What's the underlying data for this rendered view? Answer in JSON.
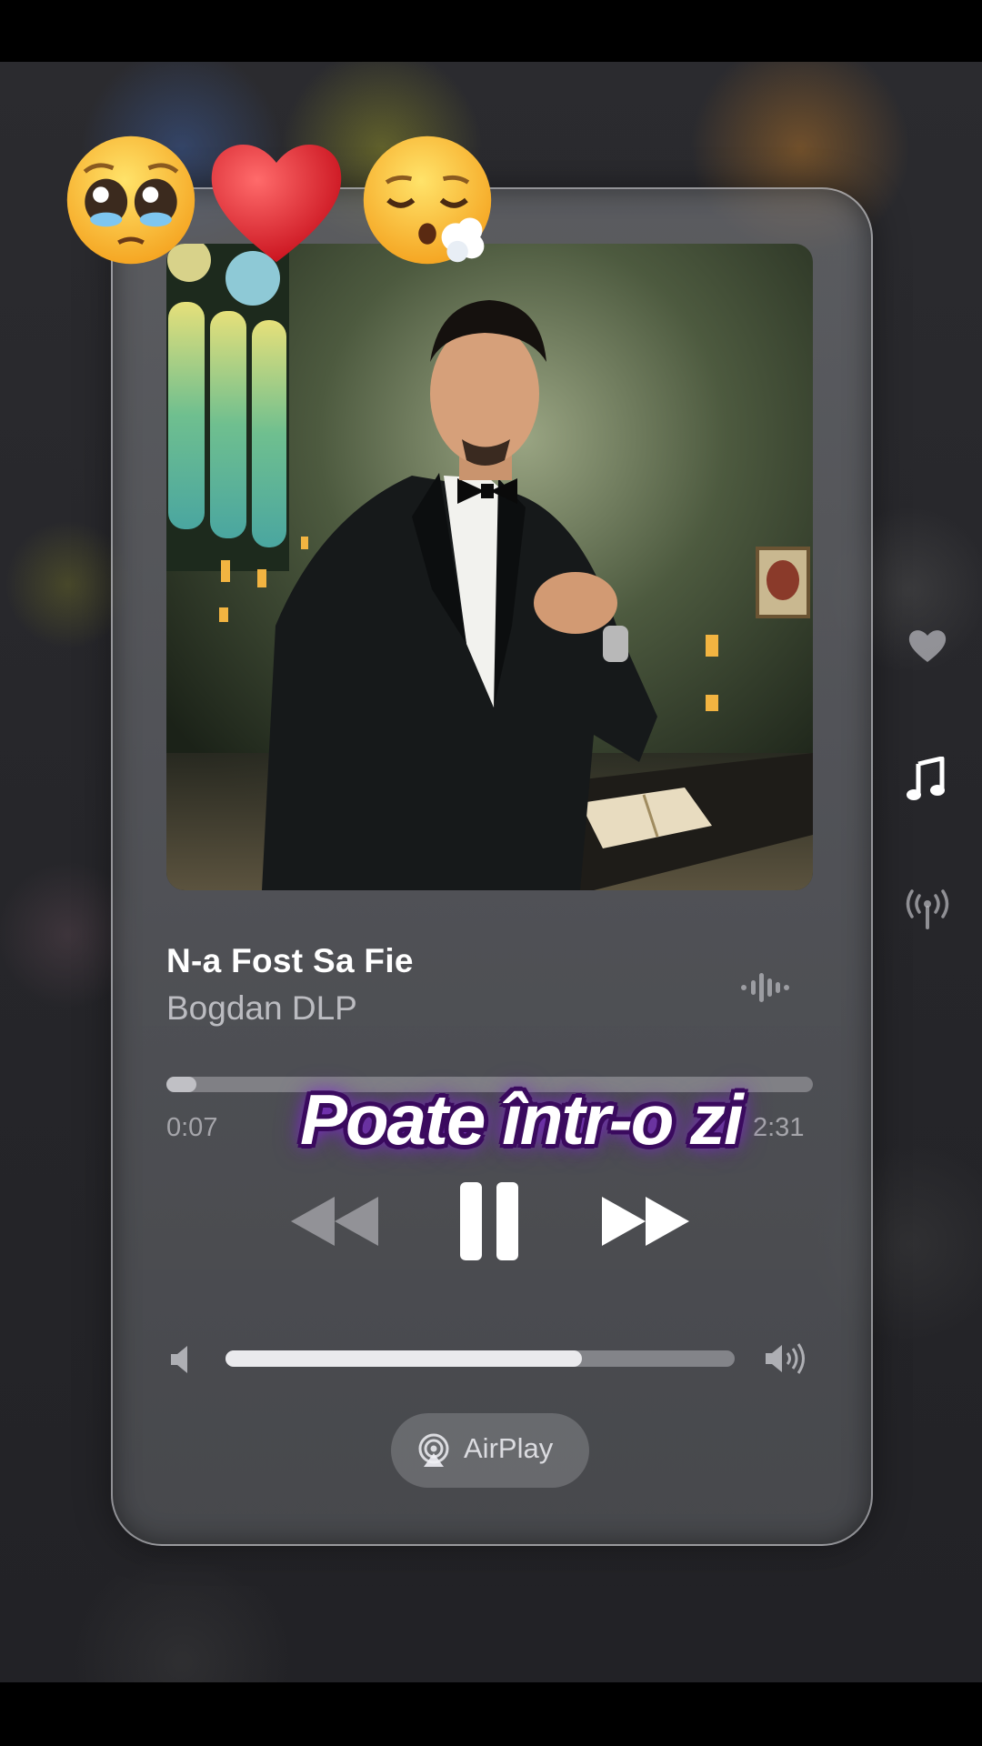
{
  "now_playing": {
    "title": "N-a Fost Sa Fie",
    "artist": "Bogdan DLP",
    "elapsed": "0:07",
    "total": "2:31",
    "progress_fraction": 0.046,
    "volume_fraction": 0.7,
    "airplay_label": "AirPlay"
  },
  "overlay": {
    "caption": "Poate într-o zi",
    "emojis": [
      "pleading-face-icon",
      "red-heart-icon",
      "sleepy-face-icon"
    ]
  },
  "controls": {
    "rewind": "rewind-icon",
    "pause": "pause-icon",
    "forward": "fast-forward-icon"
  },
  "side_rail": [
    "heart-icon",
    "music-note-icon",
    "antenna-icon"
  ],
  "colors": {
    "caption_outline": "#3a0a5e",
    "caption_glow": "#8a2be2",
    "heart": "#e3242b",
    "emoji_yellow": "#f9c22e"
  }
}
